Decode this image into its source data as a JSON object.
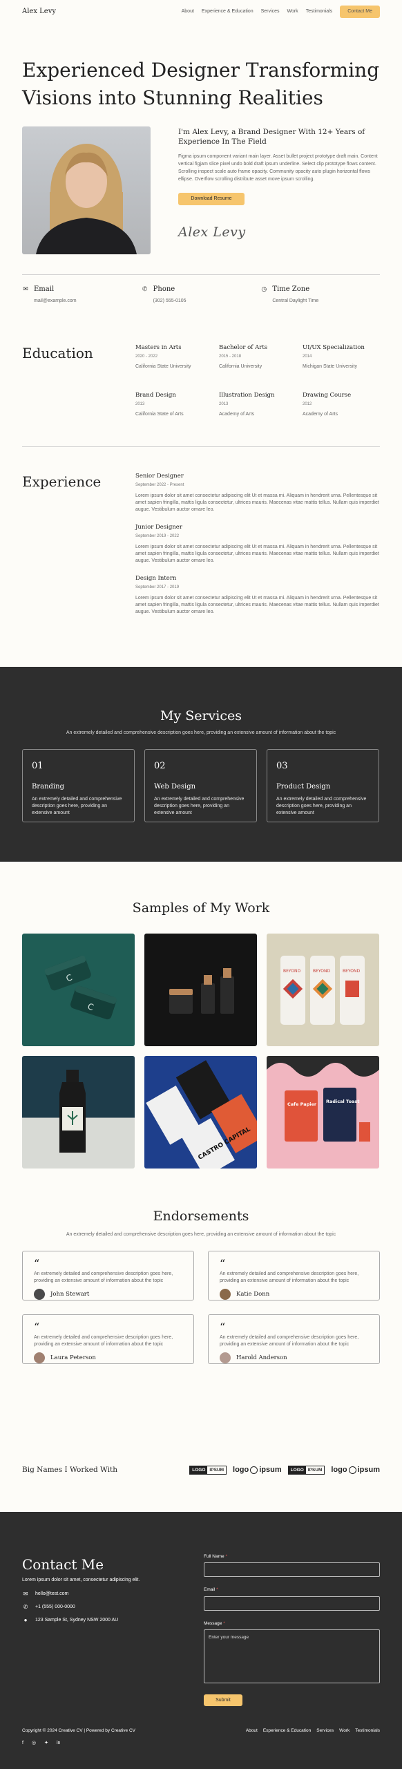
{
  "nav": {
    "logo": "Alex Levy",
    "links": [
      "About",
      "Experience & Education",
      "Services",
      "Work",
      "Testimonials"
    ],
    "cta": "Contact Me"
  },
  "hero": {
    "title": "Experienced Designer Transforming Visions into Stunning Realities",
    "subtitle": "I'm Alex Levy, a Brand Designer With 12+ Years of Experience In The Field",
    "body": "Figma ipsum component variant main layer. Asset bullet project prototype draft main. Content vertical figjam slice pixel undo bold draft ipsum underline. Select clip prototype flows content. Scrolling inspect scale auto frame opacity. Community opacity auto plugin horizontal flows ellipse. Overflow scrolling distribute asset move ipsum scrolling.",
    "download": "Download Resume",
    "signature": "Alex Levy"
  },
  "contacts": [
    {
      "label": "Email",
      "value": "mail@example.com",
      "icon": "envelope-icon"
    },
    {
      "label": "Phone",
      "value": "(302) 555-0105",
      "icon": "phone-icon"
    },
    {
      "label": "Time Zone",
      "value": "Central Daylight Time",
      "icon": "clock-icon"
    }
  ],
  "education": {
    "heading": "Education",
    "items": [
      {
        "title": "Masters in Arts",
        "years": "2020 - 2022",
        "school": "California State University"
      },
      {
        "title": "Bachelor of Arts",
        "years": "2015 - 2018",
        "school": "California University"
      },
      {
        "title": "UI/UX Specialization",
        "years": "2014",
        "school": "Michigan State University"
      },
      {
        "title": "Brand Design",
        "years": "2013",
        "school": "California State of Arts"
      },
      {
        "title": "Illustration Design",
        "years": "2013",
        "school": "Academy of Arts"
      },
      {
        "title": "Drawing Course",
        "years": "2012",
        "school": "Academy of Arts"
      }
    ]
  },
  "experience": {
    "heading": "Experience",
    "items": [
      {
        "title": "Senior Designer",
        "years": "September 2022 - Present",
        "text": "Lorem ipsum dolor sit amet consectetur adipiscing elit Ut et massa mi. Aliquam in hendrerit urna. Pellentesque sit amet sapien fringilla, mattis ligula consectetur, ultrices mauris. Maecenas vitae mattis tellus. Nullam quis imperdiet augue. Vestibulum auctor ornare leo."
      },
      {
        "title": "Junior Designer",
        "years": "September 2019 - 2022",
        "text": "Lorem ipsum dolor sit amet consectetur adipiscing elit Ut et massa mi. Aliquam in hendrerit urna. Pellentesque sit amet sapien fringilla, mattis ligula consectetur, ultrices mauris. Maecenas vitae mattis tellus. Nullam quis imperdiet augue. Vestibulum auctor ornare leo."
      },
      {
        "title": "Design Intern",
        "years": "September 2017 - 2019",
        "text": "Lorem ipsum dolor sit amet consectetur adipiscing elit Ut et massa mi. Aliquam in hendrerit urna. Pellentesque sit amet sapien fringilla, mattis ligula consectetur, ultrices mauris. Maecenas vitae mattis tellus. Nullam quis imperdiet augue. Vestibulum auctor ornare leo."
      }
    ]
  },
  "services": {
    "heading": "My Services",
    "subtitle": "An extremely detailed and comprehensive description goes here, providing an extensive amount of information about the topic",
    "items": [
      {
        "num": "01",
        "title": "Branding",
        "text": "An extremely detailed and comprehensive description goes here, providing an extensive amount"
      },
      {
        "num": "02",
        "title": "Web Design",
        "text": "An extremely detailed and comprehensive description goes here, providing an extensive amount"
      },
      {
        "num": "03",
        "title": "Product Design",
        "text": "An extremely detailed and comprehensive description goes here, providing an extensive amount"
      }
    ]
  },
  "work": {
    "heading": "Samples of My Work",
    "labels": [
      "BEYOND",
      "BEYOND",
      "BEYOND",
      "CASTRO CAPITAL",
      "Cafe Papier",
      "Radical Toast"
    ]
  },
  "endorsements": {
    "heading": "Endorsements",
    "subtitle": "An extremely detailed and comprehensive description goes here, providing an extensive amount of information about the topic",
    "quote_mark": "“",
    "items": [
      {
        "text": "An extremely detailed and comprehensive description goes here, providing an extensive amount of information about the topic",
        "name": "John Stewart",
        "avatar_color": "#4a4a4a"
      },
      {
        "text": "An extremely detailed and comprehensive description goes here, providing an extensive amount of information about the topic",
        "name": "Katie Donn",
        "avatar_color": "#8a6a4a"
      },
      {
        "text": "An extremely detailed and comprehensive description goes here, providing an extensive amount of information about the topic",
        "name": "Laura Peterson",
        "avatar_color": "#a08070"
      },
      {
        "text": "An extremely detailed and comprehensive description goes here, providing an extensive amount of information about the topic",
        "name": "Harold Anderson",
        "avatar_color": "#b39a90"
      }
    ]
  },
  "bignames": {
    "label": "Big Names I Worked With",
    "logo_box": [
      "LOGO",
      "IPSUM"
    ],
    "logo_round": [
      "logo",
      "ipsum"
    ]
  },
  "contact": {
    "heading": "Contact Me",
    "lead": "Lorem ipsum dolor sit amet, consectetur adipiscing elit.",
    "email": "hello@test.com",
    "phone": "+1 (555) 000-0000",
    "address": "123 Sample St, Sydney NSW 2000 AU",
    "form": {
      "name_label": "Full Name",
      "email_label": "Email",
      "message_label": "Message",
      "required_mark": "*",
      "message_placeholder": "Enter your message",
      "submit": "Submit"
    }
  },
  "footer": {
    "copyright": "Copyright © 2024 Creative CV | Powered by Creative CV",
    "links": [
      "About",
      "Experience & Education",
      "Services",
      "Work",
      "Testimonials"
    ],
    "socials": [
      "f",
      "◎",
      "✦",
      "in"
    ]
  },
  "colors": {
    "accent": "#f6c56d",
    "dark": "#2e2e2e",
    "bg": "#fdfcf8"
  }
}
